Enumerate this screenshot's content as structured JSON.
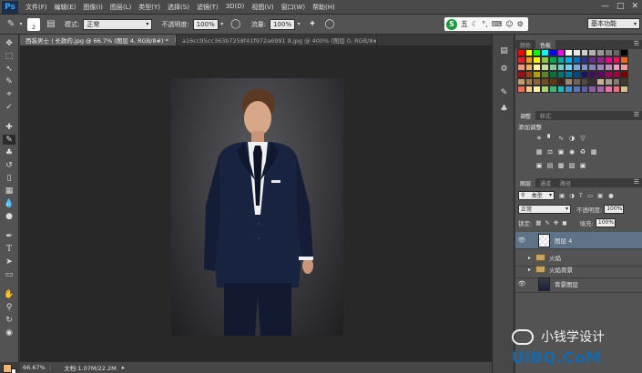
{
  "app": {
    "logo": "Ps"
  },
  "menubar": {
    "items": [
      "文件(F)",
      "编辑(E)",
      "图像(I)",
      "图层(L)",
      "类型(Y)",
      "选择(S)",
      "滤镜(T)",
      "3D(D)",
      "视图(V)",
      "窗口(W)",
      "帮助(H)"
    ],
    "controls": [
      "minimize-icon",
      "maximize-icon",
      "close-icon"
    ]
  },
  "options": {
    "brush_size": "2",
    "mode_label": "模式:",
    "mode_value": "正常",
    "opacity_label": "不透明度:",
    "opacity_value": "100%",
    "flow_label": "流量:",
    "flow_value": "100%",
    "ime_glyph": "S",
    "ime_text": "五",
    "workspace": "基本功能"
  },
  "document_tabs": [
    {
      "title": "西装男士 | 长款的.jpg @ 66.7% (图层 4, RGB/8#) *",
      "active": true
    },
    {
      "title": "a16cc95cc363b7258f41f972a6991 8.jpg @ 400% (图层 0, RGB/8#)",
      "active": false
    }
  ],
  "status": {
    "zoom": "66.67%",
    "doc_size": "文档:1.07M/22.2M"
  },
  "panels": {
    "color_tabs": [
      "颜色",
      "色板"
    ],
    "adjust_tabs": [
      "调整",
      "样式"
    ],
    "adjust_title": "添加调整",
    "layer_tabs": [
      "图层",
      "通道",
      "路径"
    ],
    "filter_kind": "类型",
    "blend_mode": "正常",
    "opacity_label": "不透明度:",
    "opacity_value": "100%",
    "lock_label": "锁定:",
    "fill_label": "填充:",
    "fill_value": "100%"
  },
  "layers": [
    {
      "name": "图层 4",
      "type": "layer",
      "visible": true,
      "selected": true
    },
    {
      "name": "火焰",
      "type": "group",
      "visible": false,
      "selected": false
    },
    {
      "name": "火焰背景",
      "type": "group",
      "visible": false,
      "selected": false
    },
    {
      "name": "背景图层",
      "type": "image",
      "visible": true,
      "selected": false
    }
  ],
  "swatch_colors": [
    "#ff0000",
    "#ffff00",
    "#00ff00",
    "#00ffff",
    "#0000ff",
    "#ff00ff",
    "#ffffff",
    "#e6e6e6",
    "#cccccc",
    "#b3b3b3",
    "#999999",
    "#808080",
    "#666666",
    "#000000",
    "#ed1c24",
    "#f7941d",
    "#fff200",
    "#8dc63f",
    "#00a651",
    "#00a99d",
    "#00aeef",
    "#0072bc",
    "#2e3192",
    "#662d91",
    "#92278f",
    "#ec008c",
    "#ed145b",
    "#f26522",
    "#f69679",
    "#fbaf5d",
    "#fff79a",
    "#c4df9b",
    "#82ca9c",
    "#7accc8",
    "#6dcff6",
    "#7da7d9",
    "#8393ca",
    "#8781bd",
    "#a186be",
    "#bd8cbf",
    "#f49ac1",
    "#f5989d",
    "#9e0b0f",
    "#a0410d",
    "#aba000",
    "#598527",
    "#007236",
    "#00746b",
    "#0076a3",
    "#004a80",
    "#1b1464",
    "#440e62",
    "#630460",
    "#9e005d",
    "#9e0039",
    "#790000",
    "#c69c6d",
    "#a67c52",
    "#8c6239",
    "#754c24",
    "#603913",
    "#42210b",
    "#998675",
    "#736357",
    "#534741",
    "#362f2d",
    "#c7b299",
    "#a69c8d",
    "#857a6f",
    "#423a34",
    "#f26c4f",
    "#fdc689",
    "#fbf4a0",
    "#acd373",
    "#3cb878",
    "#1cbbb4",
    "#448ccb",
    "#5674b9",
    "#605ca8",
    "#855fa8",
    "#a864a8",
    "#f06eaa",
    "#f26d7d",
    "#d9c18f"
  ],
  "watermark": {
    "cn": "小钱学设计",
    "url": "UiBQ.CoM"
  }
}
